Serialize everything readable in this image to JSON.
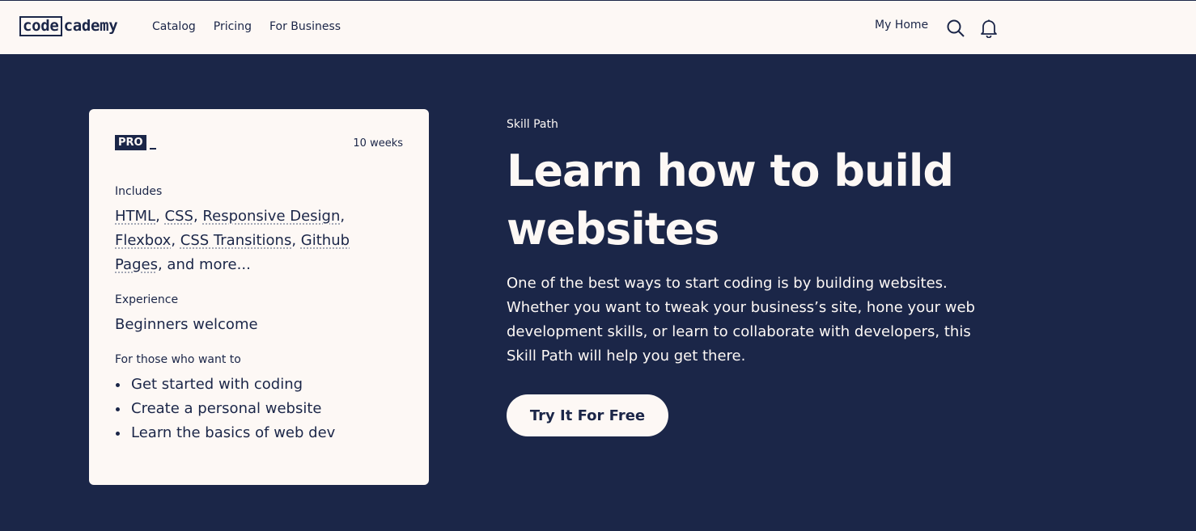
{
  "header": {
    "logo_left": "code",
    "logo_right": "cademy",
    "nav": [
      "Catalog",
      "Pricing",
      "For Business"
    ],
    "my_home": "My Home",
    "icons": [
      "search-icon",
      "bell-icon"
    ]
  },
  "card": {
    "badge": "PRO",
    "duration": "10 weeks",
    "includes_label": "Includes",
    "includes_items": [
      "HTML",
      "CSS",
      "Responsive Design",
      "Flexbox",
      "CSS Transitions",
      "Github Pages"
    ],
    "includes_suffix": ", and more...",
    "experience_label": "Experience",
    "experience_value": "Beginners welcome",
    "for_label": "For those who want to",
    "goals": [
      "Get started with coding",
      "Create a personal website",
      "Learn the basics of web dev"
    ]
  },
  "hero": {
    "eyebrow": "Skill Path",
    "title": "Learn how to build websites",
    "description": "One of the best ways to start coding is by building websites. Whether you want to tweak your business’s site, hone your web development skills, or learn to collaborate with developers, this Skill Path will help you get there.",
    "cta": "Try It For Free"
  },
  "colors": {
    "navy": "#1b2648",
    "cream": "#fdf8f5"
  }
}
